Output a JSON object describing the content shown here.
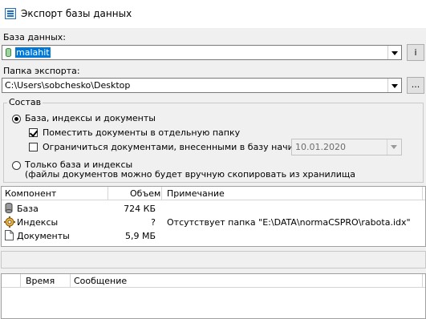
{
  "window": {
    "title": "Экспорт базы данных"
  },
  "database": {
    "label": "База данных:",
    "value": "malahit",
    "info_button": "i"
  },
  "export_folder": {
    "label": "Папка экспорта:",
    "value": "C:\\Users\\sobchesko\\Desktop",
    "browse_button": "..."
  },
  "composition": {
    "legend": "Состав",
    "option_full": "База, индексы и документы",
    "check_separate_folder": "Поместить документы в отдельную папку",
    "check_limit_docs": "Ограничиться документами, внесенными в базу начиная с",
    "date_value": "10.01.2020",
    "option_base_only": "Только база и индексы",
    "option_base_only_note": "(файлы документов можно будет вручную скопировать из хранилища"
  },
  "components_table": {
    "columns": [
      "Компонент",
      "Объем",
      "Примечание"
    ],
    "rows": [
      {
        "icon": "database-icon",
        "name": "База",
        "size": "724 КБ",
        "note": ""
      },
      {
        "icon": "gear-icon",
        "name": "Индексы",
        "size": "?",
        "note": "Отсутствует папка \"E:\\DATA\\normaCSPRO\\rabota.idx\""
      },
      {
        "icon": "document-icon",
        "name": "Документы",
        "size": "5,9 МБ",
        "note": ""
      }
    ]
  },
  "log_table": {
    "columns": [
      "",
      "Время",
      "Сообщение"
    ]
  }
}
